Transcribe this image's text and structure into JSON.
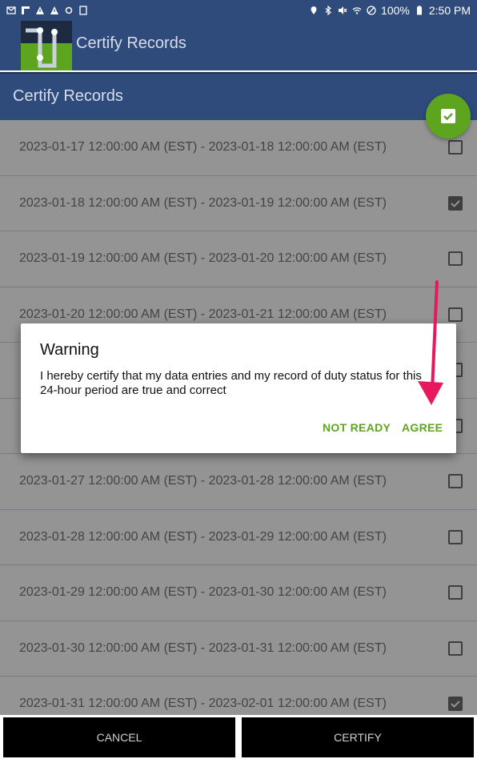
{
  "status_bar": {
    "battery": "100%",
    "time": "2:50 PM"
  },
  "app_bar": {
    "title": "Certify Records"
  },
  "sub_bar": {
    "title": "Certify Records"
  },
  "records": [
    {
      "range": "2023-01-17 12:00:00 AM (EST) - 2023-01-18 12:00:00 AM (EST)",
      "checked": false
    },
    {
      "range": "2023-01-18 12:00:00 AM (EST) - 2023-01-19 12:00:00 AM (EST)",
      "checked": true
    },
    {
      "range": "2023-01-19 12:00:00 AM (EST) - 2023-01-20 12:00:00 AM (EST)",
      "checked": false
    },
    {
      "range": "2023-01-20 12:00:00 AM (EST) - 2023-01-21 12:00:00 AM (EST)",
      "checked": false
    },
    {
      "range": "",
      "checked": false
    },
    {
      "range": "",
      "checked": false
    },
    {
      "range": "2023-01-27 12:00:00 AM (EST) - 2023-01-28 12:00:00 AM (EST)",
      "checked": false
    },
    {
      "range": "2023-01-28 12:00:00 AM (EST) - 2023-01-29 12:00:00 AM (EST)",
      "checked": false
    },
    {
      "range": "2023-01-29 12:00:00 AM (EST) - 2023-01-30 12:00:00 AM (EST)",
      "checked": false
    },
    {
      "range": "2023-01-30 12:00:00 AM (EST) - 2023-01-31 12:00:00 AM (EST)",
      "checked": false
    },
    {
      "range": "2023-01-31 12:00:00 AM (EST) - 2023-02-01 12:00:00 AM (EST)",
      "checked": true
    }
  ],
  "dialog": {
    "title": "Warning",
    "message": "I hereby certify that my data entries and my record of duty status for this 24-hour period are true and correct",
    "not_ready_label": "NOT READY",
    "agree_label": "AGREE"
  },
  "bottom": {
    "cancel_label": "CANCEL",
    "certify_label": "CERTIFY"
  },
  "colors": {
    "primary": "#2f4b7c",
    "accent": "#5da51e",
    "annotation_arrow": "#e8185c"
  }
}
